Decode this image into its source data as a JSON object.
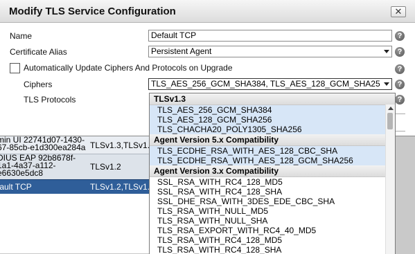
{
  "dialog": {
    "title": "Modify TLS Service Configuration",
    "close_label": "✕",
    "help_label": "?",
    "fields": {
      "name_label": "Name",
      "name_value": "Default TCP",
      "cert_label": "Certificate Alias",
      "cert_value": "Persistent Agent",
      "auto_update_label": "Automatically Update Ciphers And Protocols on Upgrade",
      "ciphers_label": "Ciphers",
      "ciphers_value": "TLS_AES_256_GCM_SHA384, TLS_AES_128_GCM_SHA25",
      "protocols_label": "TLS Protocols"
    }
  },
  "background_table": {
    "rows": [
      {
        "c1a": "min UI 22741d07-1430-",
        "c1b": "67-85cb-e1d300ea284a",
        "c2": "TLSv1.3,TLSv1."
      },
      {
        "c1a": "DIUS EAP 92b8678f-",
        "c1b": "1a1-4a37-a112-",
        "c1c": "e6630e5dc8",
        "c2": "TLSv1.2"
      },
      {
        "c1a": "fault TCP",
        "c2": "TLSv1.2,TLSv1."
      }
    ]
  },
  "dropdown": {
    "groups": [
      {
        "label": "TLSv1.3",
        "options": [
          {
            "label": "TLS_AES_256_GCM_SHA384",
            "selected": true
          },
          {
            "label": "TLS_AES_128_GCM_SHA256",
            "selected": true
          },
          {
            "label": "TLS_CHACHA20_POLY1305_SHA256",
            "selected": true
          }
        ]
      },
      {
        "label": "Agent Version 5.x Compatibility",
        "options": [
          {
            "label": "TLS_ECDHE_RSA_WITH_AES_128_CBC_SHA",
            "selected": true
          },
          {
            "label": "TLS_ECDHE_RSA_WITH_AES_128_GCM_SHA256",
            "selected": true
          }
        ]
      },
      {
        "label": "Agent Version 3.x Compatibility",
        "options": [
          {
            "label": "SSL_RSA_WITH_RC4_128_MD5",
            "selected": false
          },
          {
            "label": "SSL_RSA_WITH_RC4_128_SHA",
            "selected": false
          },
          {
            "label": "SSL_DHE_RSA_WITH_3DES_EDE_CBC_SHA",
            "selected": false
          },
          {
            "label": "TLS_RSA_WITH_NULL_MD5",
            "selected": false
          },
          {
            "label": "TLS_RSA_WITH_NULL_SHA",
            "selected": false
          },
          {
            "label": "TLS_RSA_EXPORT_WITH_RC4_40_MD5",
            "selected": false
          },
          {
            "label": "TLS_RSA_WITH_RC4_128_MD5",
            "selected": false
          },
          {
            "label": "TLS_RSA_WITH_RC4_128_SHA",
            "selected": false
          }
        ]
      }
    ]
  },
  "colors": {
    "selected_row": "#2f5e99",
    "selected_option": "#d7e6f7"
  }
}
